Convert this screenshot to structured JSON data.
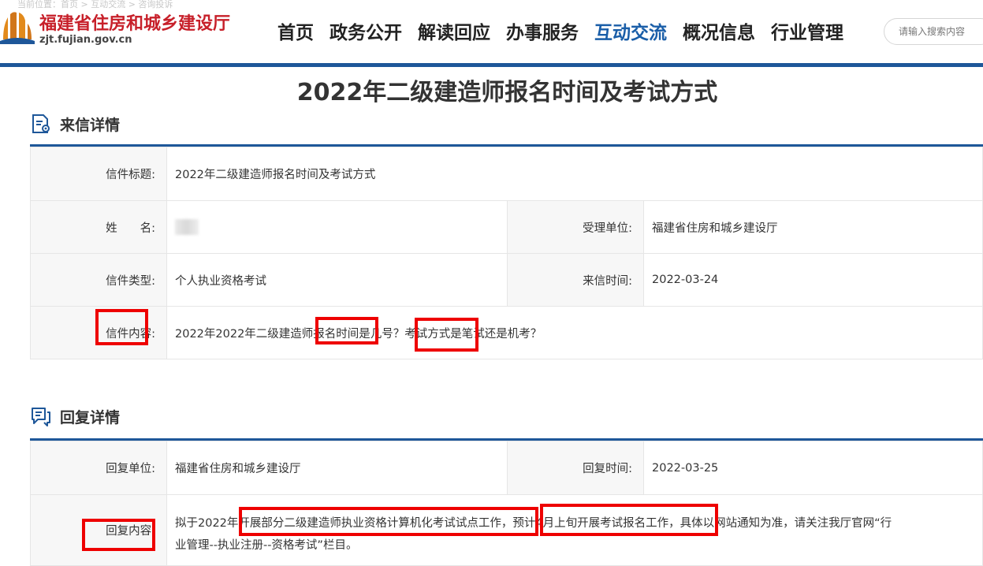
{
  "header": {
    "breadcrumb": "当前位置：首页 > 互动交流 > 咨询投诉",
    "logo_cn": "福建省住房和城乡建设厅",
    "logo_url": "zjt.fujian.gov.cn",
    "nav": [
      "首页",
      "政务公开",
      "解读回应",
      "办事服务",
      "互动交流",
      "概况信息",
      "行业管理"
    ],
    "active_nav": "互动交流",
    "search_placeholder": "请输入搜索内容"
  },
  "page_title": "2022年二级建造师报名时间及考试方式",
  "letter": {
    "heading": "来信详情",
    "title_label": "信件标题:",
    "title_value": "2022年二级建造师报名时间及考试方式",
    "name_label": "姓　　名:",
    "dept_label": "受理单位:",
    "dept_value": "福建省住房和城乡建设厅",
    "type_label": "信件类型:",
    "type_value": "个人执业资格考试",
    "date_label": "来信时间:",
    "date_value": "2022-03-24",
    "content_label": "信件内容:",
    "content_value": "2022年2022年二级建造师报名时间是几号？考试方式是笔试还是机考？"
  },
  "reply": {
    "heading": "回复详情",
    "unit_label": "回复单位:",
    "unit_value": "福建省住房和城乡建设厅",
    "date_label": "回复时间:",
    "date_value": "2022-03-25",
    "content_label": "回复内容:",
    "content_line1": "拟于2022年开展部分二级建造师执业资格计算机化考试试点工作，预计4月上旬开展考试报名工作，具体以网站通知为准，请关注我厅官网“行",
    "content_line2": "业管理--执业注册--资格考试”栏目。"
  },
  "colors": {
    "accent": "#1e5799",
    "logo_red": "#c7202a",
    "highlight": "#ee0000"
  }
}
